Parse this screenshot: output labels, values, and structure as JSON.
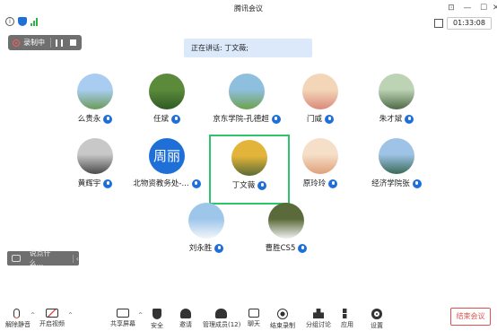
{
  "window": {
    "title": "腾讯会议",
    "timer": "01:33:08"
  },
  "recording": {
    "label": "录制中"
  },
  "speaking_banner": "正在讲话: 丁文薇;",
  "participants": [
    {
      "name": "么贵永",
      "avatar_type": "image",
      "colors": [
        "#a9cdf0",
        "#6a9a5a"
      ]
    },
    {
      "name": "任斌",
      "avatar_type": "image",
      "colors": [
        "#5a8a3a",
        "#2f5a25"
      ]
    },
    {
      "name": "京东学院-孔德超",
      "avatar_type": "image",
      "colors": [
        "#8fbfdf",
        "#6da24d"
      ]
    },
    {
      "name": "门威",
      "avatar_type": "image",
      "colors": [
        "#f3d6b8",
        "#d98a7a"
      ]
    },
    {
      "name": "朱才斌",
      "avatar_type": "image",
      "colors": [
        "#bcd3b4",
        "#4f6a45"
      ]
    },
    {
      "name": "黄辉宇",
      "avatar_type": "image",
      "colors": [
        "#c8c8c8",
        "#4a4a4a"
      ]
    },
    {
      "name": "北物资教务处-...",
      "avatar_type": "text",
      "avatar_text": "周丽"
    },
    {
      "name": "丁文薇",
      "avatar_type": "image",
      "colors": [
        "#e3b43a",
        "#5a6b35"
      ]
    },
    {
      "name": "原玲玲",
      "avatar_type": "image",
      "colors": [
        "#f5dfc8",
        "#e0a07a"
      ]
    },
    {
      "name": "经济学院张",
      "avatar_type": "image",
      "colors": [
        "#9fc3e6",
        "#3a6a5a"
      ]
    },
    {
      "name": "刘永胜",
      "avatar_type": "image",
      "colors": [
        "#9ec6ea",
        "#f2f6fa"
      ]
    },
    {
      "name": "曹胜CS5",
      "avatar_type": "image",
      "colors": [
        "#5a6a3a",
        "#f0f0f0"
      ]
    }
  ],
  "chat": {
    "placeholder": "说点什么..."
  },
  "toolbar": {
    "items": [
      {
        "label": "解除静音",
        "icon": "mic-muted-icon"
      },
      {
        "label": "开启视频",
        "icon": "video-off-icon"
      },
      {
        "label": "共享屏幕",
        "icon": "share-screen-icon"
      },
      {
        "label": "安全",
        "icon": "shield-icon"
      },
      {
        "label": "邀请",
        "icon": "invite-icon"
      },
      {
        "label": "管理成员(12)",
        "icon": "members-icon"
      },
      {
        "label": "聊天",
        "icon": "chat-icon"
      },
      {
        "label": "结束录制",
        "icon": "record-stop-icon"
      },
      {
        "label": "分组讨论",
        "icon": "breakout-icon"
      },
      {
        "label": "应用",
        "icon": "apps-icon"
      },
      {
        "label": "设置",
        "icon": "gear-icon"
      }
    ],
    "end_label": "结束会议"
  },
  "colors": {
    "accent": "#1f6fd8",
    "active_border": "#2fc36a",
    "end_red": "#e05050"
  }
}
